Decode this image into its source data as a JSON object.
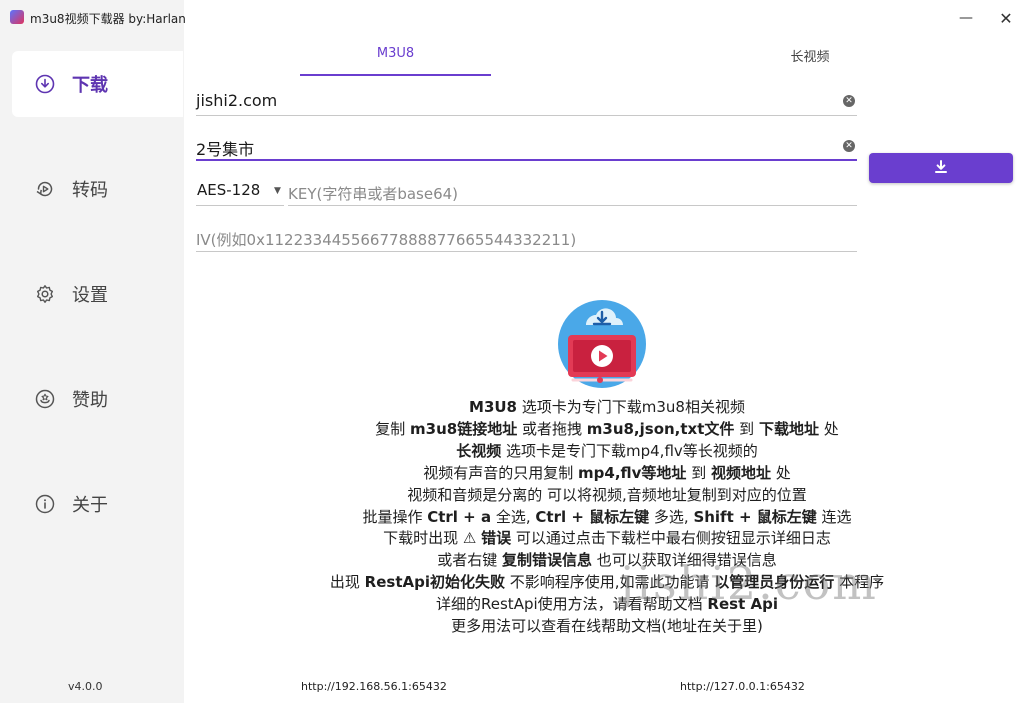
{
  "window": {
    "title": "m3u8视频下载器 by:Harlan",
    "minimize_glyph": "—",
    "close_glyph": "✕"
  },
  "sidebar": {
    "items": [
      {
        "label": "下载",
        "icon": "download-circle-icon",
        "active": true
      },
      {
        "label": "转码",
        "icon": "transcode-icon",
        "active": false
      },
      {
        "label": "设置",
        "icon": "gear-icon",
        "active": false
      },
      {
        "label": "赞助",
        "icon": "sponsor-icon",
        "active": false
      },
      {
        "label": "关于",
        "icon": "info-icon",
        "active": false
      }
    ],
    "version": "v4.0.0"
  },
  "tabs": [
    {
      "label": "M3U8",
      "selected": true
    },
    {
      "label": "长视频",
      "selected": false
    }
  ],
  "form": {
    "url_value": "jishi2.com",
    "name_value": "2号集市",
    "encryption_selected": "AES-128",
    "key_placeholder": "KEY(字符串或者base64)",
    "iv_placeholder": "IV(例如0x112233445566778888776655443322​11)"
  },
  "help_lines": [
    [
      {
        "t": "M3U8",
        "b": true
      },
      {
        "t": " 选项卡为专门下载m3u8相关视频",
        "b": false
      }
    ],
    [
      {
        "t": "复制 ",
        "b": false
      },
      {
        "t": "m3u8链接地址",
        "b": true
      },
      {
        "t": " 或者拖拽 ",
        "b": false
      },
      {
        "t": "m3u8,json,txt文件",
        "b": true
      },
      {
        "t": " 到 ",
        "b": false
      },
      {
        "t": "下载地址",
        "b": true
      },
      {
        "t": " 处",
        "b": false
      }
    ],
    [
      {
        "t": "长视频",
        "b": true
      },
      {
        "t": " 选项卡是专门下载mp4,flv等长视频的",
        "b": false
      }
    ],
    [
      {
        "t": "视频有声音的只用复制 ",
        "b": false
      },
      {
        "t": "mp4,flv等地址",
        "b": true
      },
      {
        "t": " 到 ",
        "b": false
      },
      {
        "t": "视频地址",
        "b": true
      },
      {
        "t": " 处",
        "b": false
      }
    ],
    [
      {
        "t": "视频和音频是分离的 可以将视频,音频地址复制到对应的位置",
        "b": false
      }
    ],
    [
      {
        "t": "批量操作 ",
        "b": false
      },
      {
        "t": "Ctrl + a",
        "b": true
      },
      {
        "t": " 全选, ",
        "b": false
      },
      {
        "t": "Ctrl + 鼠标左键",
        "b": true
      },
      {
        "t": " 多选, ",
        "b": false
      },
      {
        "t": "Shift + 鼠标左键",
        "b": true
      },
      {
        "t": " 连选",
        "b": false
      }
    ],
    [
      {
        "t": "下载时出现 ⚠ ",
        "b": false
      },
      {
        "t": "错误",
        "b": true
      },
      {
        "t": " 可以通过点击下载栏中最右侧按钮显示详细日志",
        "b": false
      }
    ],
    [
      {
        "t": "或者右键 ",
        "b": false
      },
      {
        "t": "复制错误信息",
        "b": true
      },
      {
        "t": " 也可以获取详细得错误信息",
        "b": false
      }
    ],
    [
      {
        "t": "出现 ",
        "b": false
      },
      {
        "t": "RestApi初始化失败",
        "b": true
      },
      {
        "t": " 不影响程序使用,如需此功能请 ",
        "b": false
      },
      {
        "t": "以管理员身份运行",
        "b": true
      },
      {
        "t": " 本程序",
        "b": false
      }
    ],
    [
      {
        "t": "详细的RestApi使用方法，请看帮助文档 ",
        "b": false
      },
      {
        "t": "Rest Api",
        "b": true
      }
    ],
    [
      {
        "t": "更多用法可以查看在线帮助文档(地址在关于里)",
        "b": false
      }
    ]
  ],
  "footer": {
    "url_left": "http://192.168.56.1:65432",
    "url_right": "http://127.0.0.1:65432"
  },
  "watermark": "jishi2.com",
  "colors": {
    "accent": "#6a3ecf",
    "sidebar_bg": "#f3f3f3"
  }
}
